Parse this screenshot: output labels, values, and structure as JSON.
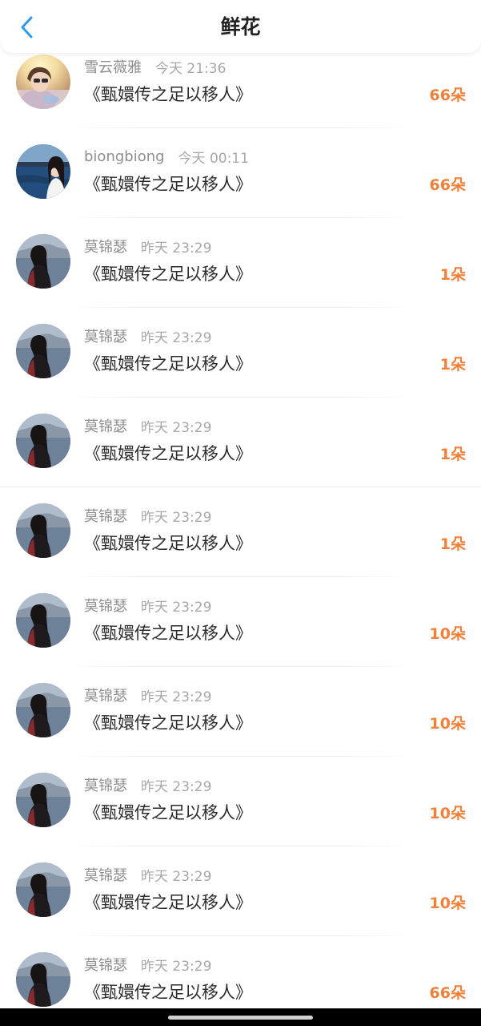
{
  "header": {
    "title": "鲜花"
  },
  "records": [
    {
      "user": "雪云薇雅",
      "time": "今天 21:36",
      "book": "《甄嬛传之足以移人》",
      "amount": "66朵",
      "avatar": "sunny-girl"
    },
    {
      "user": "biongbiong",
      "time": "今天 00:11",
      "book": "《甄嬛传之足以移人》",
      "amount": "66朵",
      "avatar": "lake-girl"
    },
    {
      "user": "莫锦瑟",
      "time": "昨天 23:29",
      "book": "《甄嬛传之足以移人》",
      "amount": "1朵",
      "avatar": "seaside-girl"
    },
    {
      "user": "莫锦瑟",
      "time": "昨天 23:29",
      "book": "《甄嬛传之足以移人》",
      "amount": "1朵",
      "avatar": "seaside-girl"
    },
    {
      "user": "莫锦瑟",
      "time": "昨天 23:29",
      "book": "《甄嬛传之足以移人》",
      "amount": "1朵",
      "avatar": "seaside-girl"
    },
    {
      "user": "莫锦瑟",
      "time": "昨天 23:29",
      "book": "《甄嬛传之足以移人》",
      "amount": "1朵",
      "avatar": "seaside-girl"
    },
    {
      "user": "莫锦瑟",
      "time": "昨天 23:29",
      "book": "《甄嬛传之足以移人》",
      "amount": "10朵",
      "avatar": "seaside-girl"
    },
    {
      "user": "莫锦瑟",
      "time": "昨天 23:29",
      "book": "《甄嬛传之足以移人》",
      "amount": "10朵",
      "avatar": "seaside-girl"
    },
    {
      "user": "莫锦瑟",
      "time": "昨天 23:29",
      "book": "《甄嬛传之足以移人》",
      "amount": "10朵",
      "avatar": "seaside-girl"
    },
    {
      "user": "莫锦瑟",
      "time": "昨天 23:29",
      "book": "《甄嬛传之足以移人》",
      "amount": "10朵",
      "avatar": "seaside-girl"
    },
    {
      "user": "莫锦瑟",
      "time": "昨天 23:29",
      "book": "《甄嬛传之足以移人》",
      "amount": "66朵",
      "avatar": "seaside-girl"
    }
  ],
  "icons": {
    "back": "chevron-left-icon"
  },
  "colors": {
    "accent_blue": "#2e9bf0",
    "amount_orange": "#f0803a",
    "title": "#222222",
    "meta_gray": "#8f8f8f"
  }
}
